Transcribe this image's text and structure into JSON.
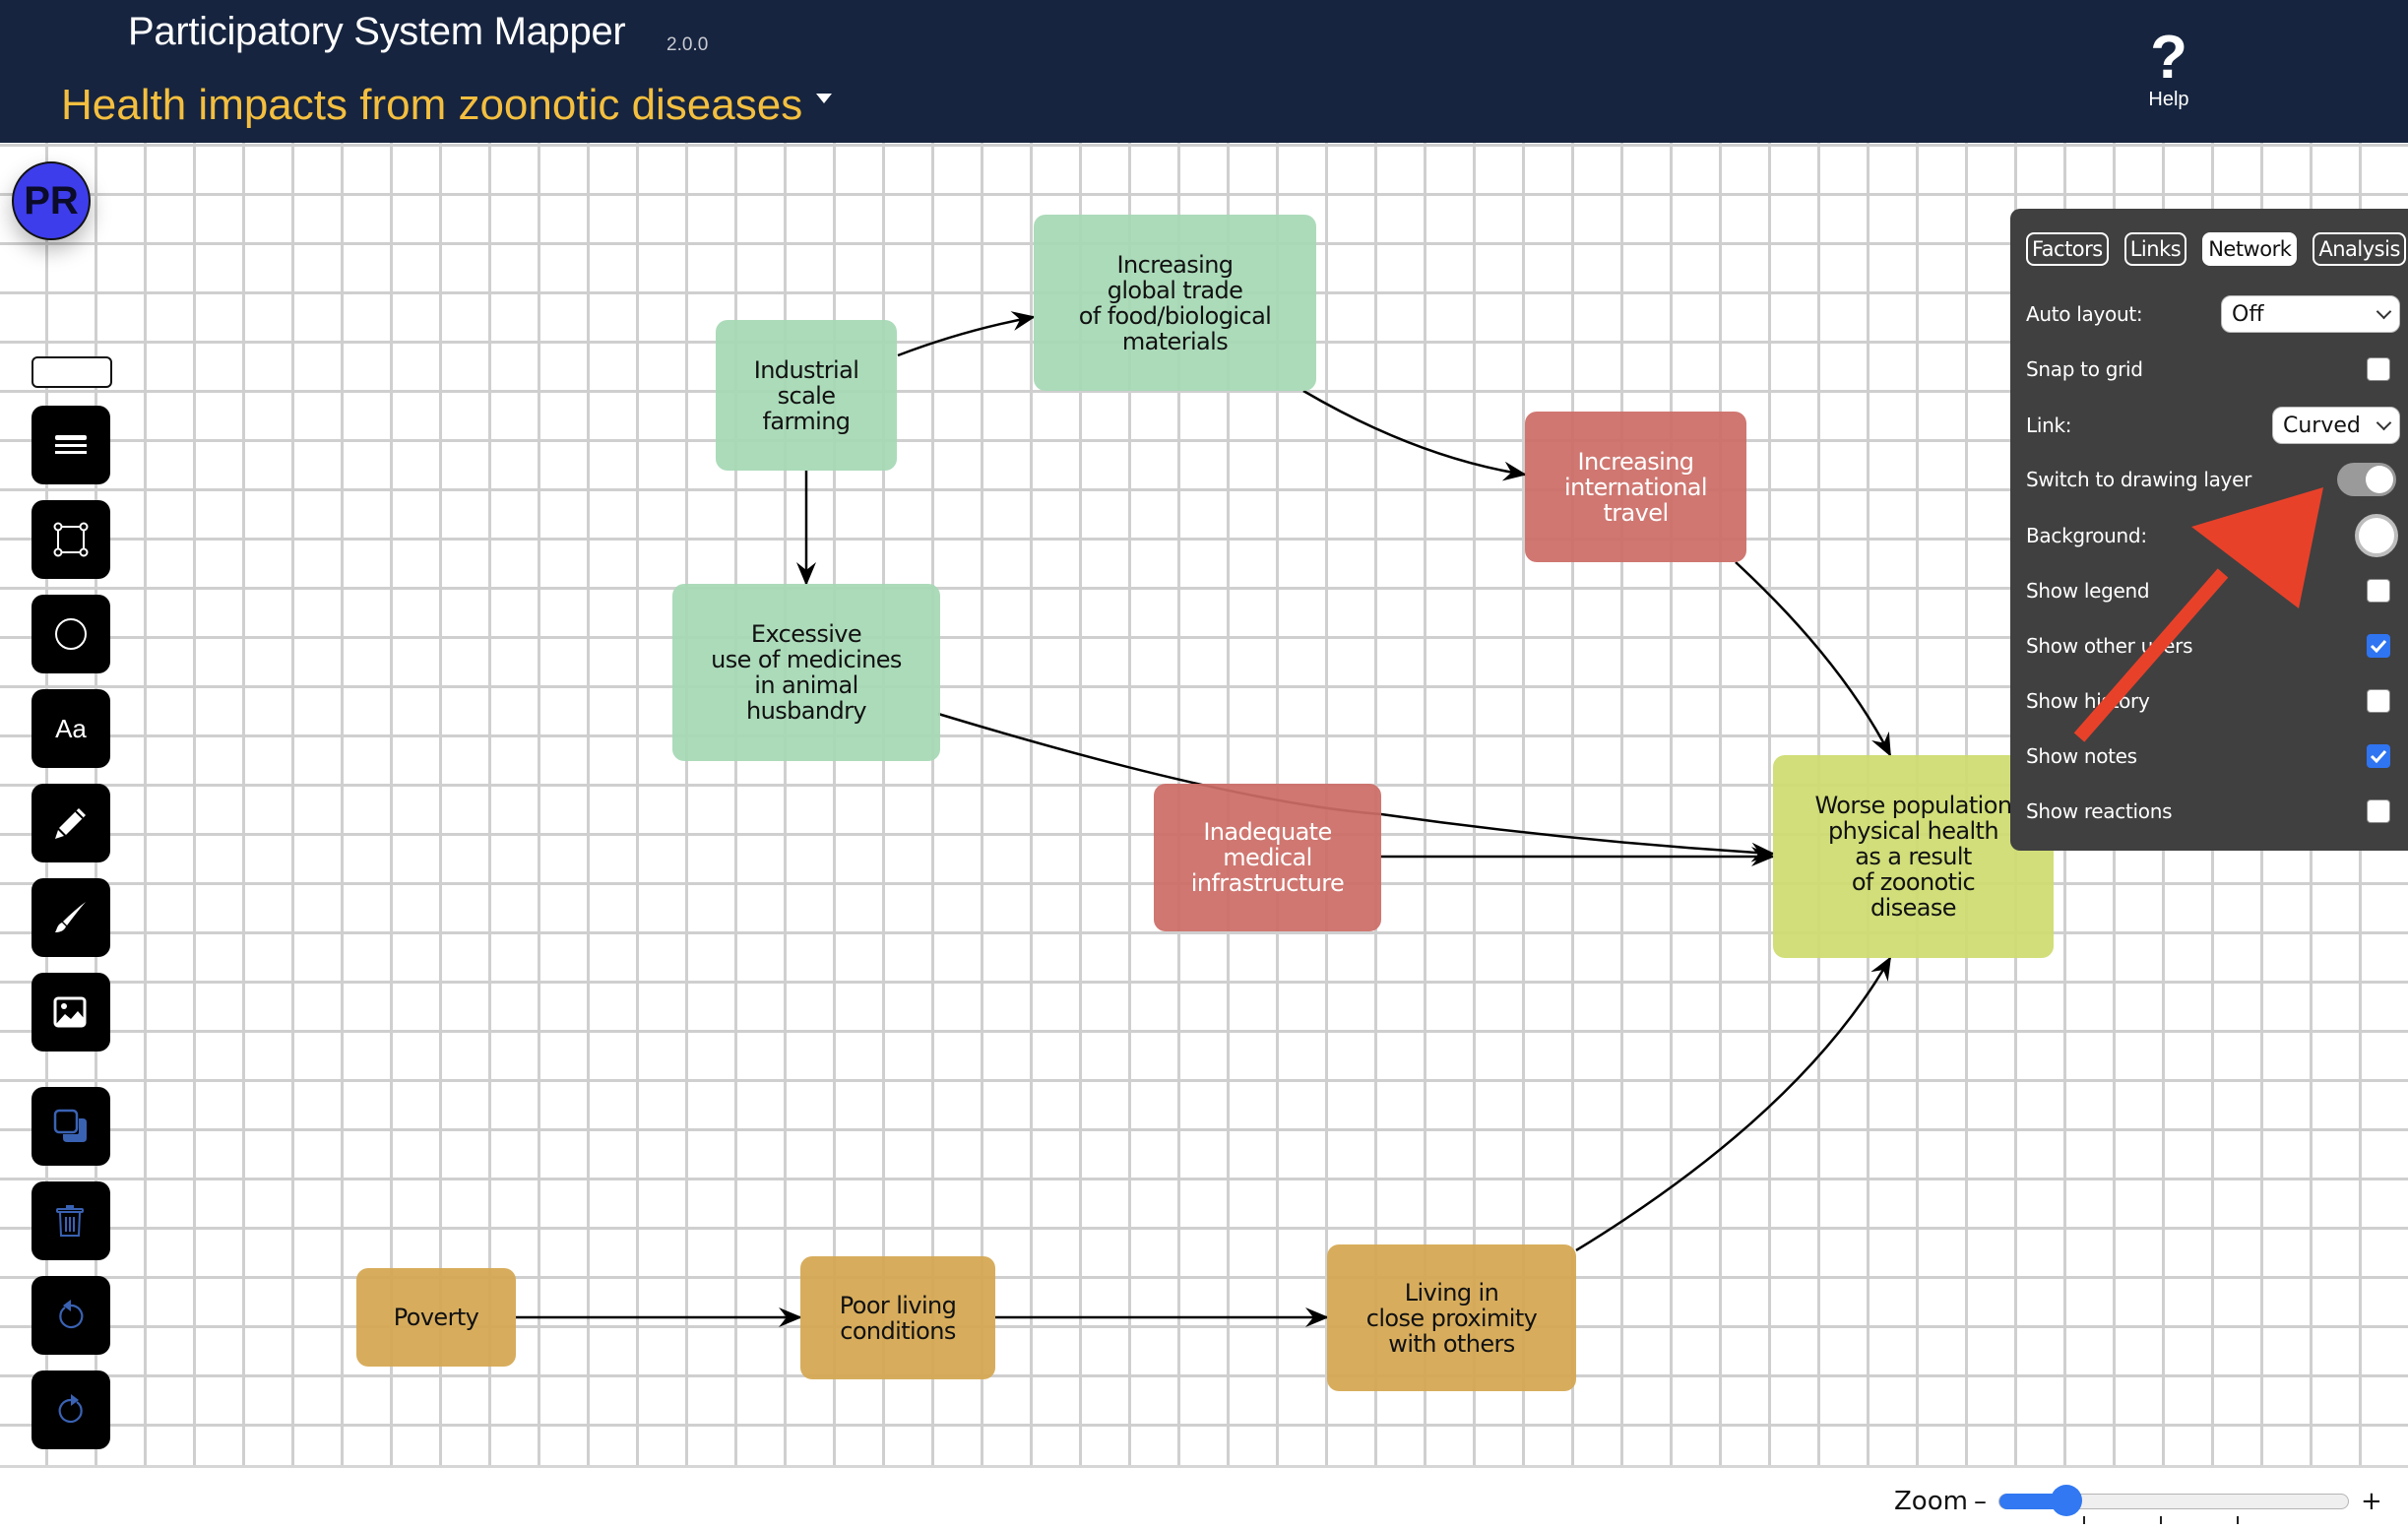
{
  "header": {
    "app_title": "Participatory System Mapper",
    "version": "2.0.0",
    "map_title": "Health impacts from zoonotic diseases",
    "help_label": "Help",
    "help_icon": "question-mark-icon"
  },
  "user": {
    "initials": "PR",
    "avatar_color": "#3d3deb"
  },
  "toolbar": {
    "items": [
      {
        "name": "add-factor-shape",
        "icon": "rounded-rectangle-icon"
      },
      {
        "name": "menu",
        "icon": "hamburger-menu-icon"
      },
      {
        "name": "rectangle-tool",
        "icon": "rectangle-select-icon"
      },
      {
        "name": "circle-tool",
        "icon": "circle-icon"
      },
      {
        "name": "text-tool",
        "icon": "text-icon",
        "label": "Aa"
      },
      {
        "name": "pencil-tool",
        "icon": "pencil-icon"
      },
      {
        "name": "brush-tool",
        "icon": "brush-icon"
      },
      {
        "name": "image-tool",
        "icon": "image-icon"
      },
      {
        "name": "copy",
        "icon": "copy-icon"
      },
      {
        "name": "delete",
        "icon": "trash-icon"
      },
      {
        "name": "undo",
        "icon": "undo-icon"
      },
      {
        "name": "redo",
        "icon": "redo-icon"
      }
    ]
  },
  "network": {
    "factors": [
      {
        "id": "industrial",
        "label": "Industrial\nscale\nfarming",
        "fill": "#a6d8b5",
        "text_color": "#111111"
      },
      {
        "id": "trade",
        "label": "Increasing\nglobal trade\nof food/biological\nmaterials",
        "fill": "#a6d8b5",
        "text_color": "#111111"
      },
      {
        "id": "travel",
        "label": "Increasing\ninternational\ntravel",
        "fill": "#cc6d66",
        "text_color": "#ffffff"
      },
      {
        "id": "excessive",
        "label": "Excessive\nuse of medicines\nin animal\nhusbandry",
        "fill": "#a6d8b5",
        "text_color": "#111111"
      },
      {
        "id": "inadequate",
        "label": "Inadequate\nmedical\ninfrastructure",
        "fill": "#cc6d66",
        "text_color": "#ffffff"
      },
      {
        "id": "worse",
        "label": "Worse population\nphysical health\nas a result\nof zoonotic\ndisease",
        "fill": "#cedb6f",
        "text_color": "#111111"
      },
      {
        "id": "poverty",
        "label": "Poverty",
        "fill": "#d4a751",
        "text_color": "#111111"
      },
      {
        "id": "poorliving",
        "label": "Poor living\nconditions",
        "fill": "#d4a751",
        "text_color": "#111111"
      },
      {
        "id": "living",
        "label": "Living in\nclose proximity\nwith others",
        "fill": "#d4a751",
        "text_color": "#111111"
      }
    ],
    "links": [
      {
        "from": "industrial",
        "to": "trade"
      },
      {
        "from": "industrial",
        "to": "excessive"
      },
      {
        "from": "trade",
        "to": "travel"
      },
      {
        "from": "travel",
        "to": "worse"
      },
      {
        "from": "excessive",
        "to": "worse"
      },
      {
        "from": "inadequate",
        "to": "worse"
      },
      {
        "from": "poverty",
        "to": "poorliving"
      },
      {
        "from": "poorliving",
        "to": "living"
      },
      {
        "from": "living",
        "to": "worse"
      }
    ]
  },
  "panel": {
    "tabs": [
      {
        "label": "Factors",
        "active": false
      },
      {
        "label": "Links",
        "active": false
      },
      {
        "label": "Network",
        "active": true
      },
      {
        "label": "Analysis",
        "active": false
      }
    ],
    "auto_layout": {
      "label": "Auto layout:",
      "value": "Off"
    },
    "snap_to_grid": {
      "label": "Snap to grid",
      "checked": false
    },
    "link": {
      "label": "Link:",
      "value": "Curved"
    },
    "drawing_layer": {
      "label": "Switch to drawing layer",
      "on": false
    },
    "background": {
      "label": "Background:",
      "color": "#ffffff"
    },
    "show_legend": {
      "label": "Show legend",
      "checked": false
    },
    "show_other_users": {
      "label": "Show other users",
      "checked": true
    },
    "show_history": {
      "label": "Show history",
      "checked": false
    },
    "show_notes": {
      "label": "Show notes",
      "checked": true
    },
    "show_reactions": {
      "label": "Show reactions",
      "checked": false
    }
  },
  "annotation": {
    "type": "arrow",
    "color": "#e8412a",
    "points_to": "drawing_layer_toggle"
  },
  "zoom": {
    "label": "Zoom",
    "minus": "–",
    "plus": "+",
    "value_fraction": 0.19
  }
}
